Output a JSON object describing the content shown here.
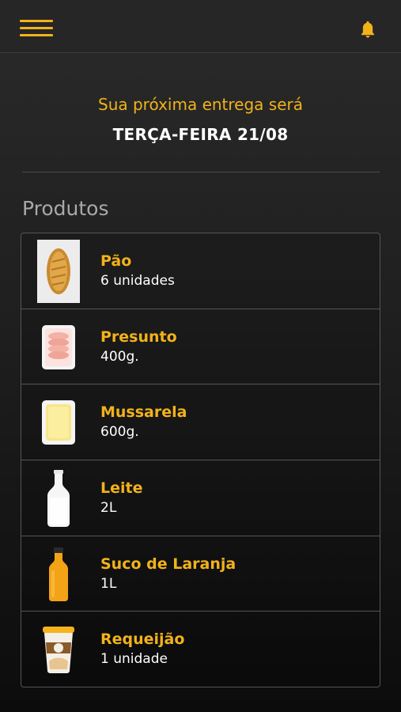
{
  "header": {
    "menu_icon": "hamburger-menu-icon",
    "bell_icon": "bell-icon",
    "accent_color": "#f2b21a"
  },
  "delivery": {
    "label": "Sua próxima entrega será",
    "date": "TERÇA-FEIRA 21/08"
  },
  "products_section": {
    "title": "Produtos",
    "items": [
      {
        "name": "Pão",
        "quantity": "6 unidades",
        "icon": "bread-icon"
      },
      {
        "name": "Presunto",
        "quantity": "400g.",
        "icon": "ham-package-icon"
      },
      {
        "name": "Mussarela",
        "quantity": "600g.",
        "icon": "cheese-package-icon"
      },
      {
        "name": "Leite",
        "quantity": "2L",
        "icon": "milk-bottle-icon"
      },
      {
        "name": "Suco de Laranja",
        "quantity": "1L",
        "icon": "orange-juice-bottle-icon"
      },
      {
        "name": "Requeijão",
        "quantity": "1 unidade",
        "icon": "cream-cheese-cup-icon"
      }
    ]
  }
}
